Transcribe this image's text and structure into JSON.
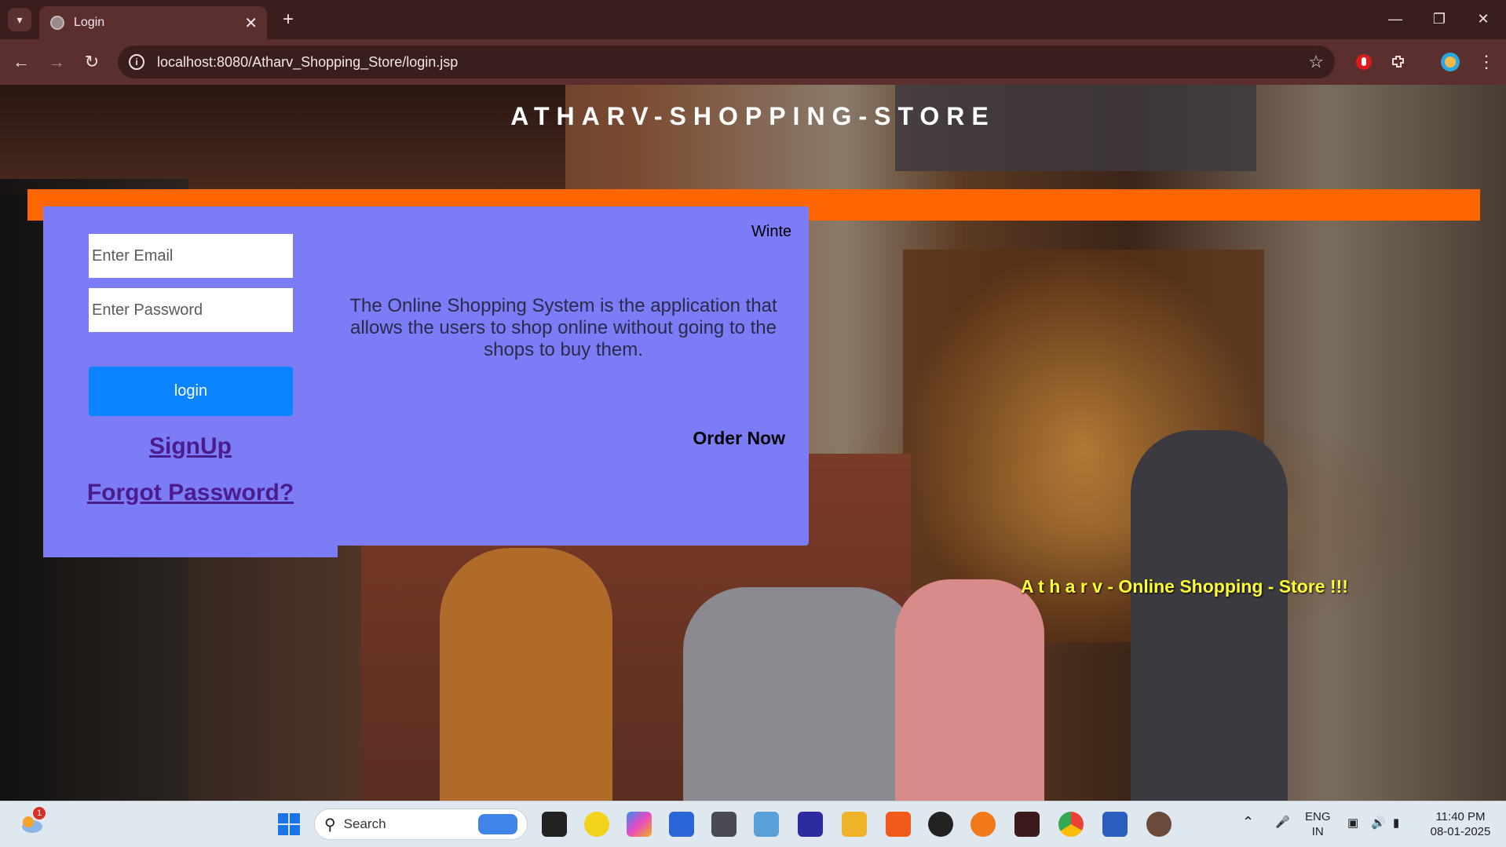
{
  "browser": {
    "tab_title": "Login",
    "url": "localhost:8080/Atharv_Shopping_Store/login.jsp"
  },
  "page": {
    "site_title": "ATHARV-SHOPPING-STORE",
    "email_placeholder": "Enter Email",
    "password_placeholder": "Enter Password",
    "login_label": "login",
    "signup_label": "SignUp",
    "forgot_label": "Forgot Password?",
    "marquee_text": "Winte",
    "description": "The Online Shopping System is the application that allows the users to shop online without going to the shops to buy them.",
    "order_now": "Order Now",
    "tagline": "A t h a r v - Online Shopping - Store !!!"
  },
  "taskbar": {
    "search_label": "Search",
    "weather_badge": "1",
    "lang_line1": "ENG",
    "lang_line2": "IN",
    "time": "11:40 PM",
    "date": "08-01-2025"
  },
  "colors": {
    "band": "#ff6600",
    "panel": "#7b7cf6",
    "login_button": "#0a84ff",
    "tagline": "#ffff33"
  }
}
